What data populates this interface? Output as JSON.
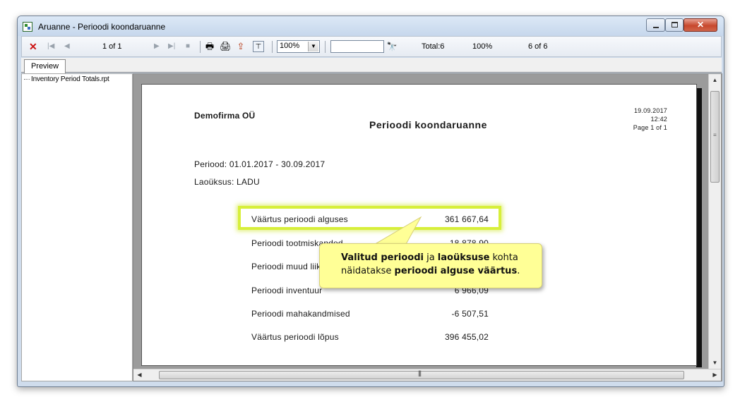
{
  "window": {
    "title": "Aruanne - Perioodi koondaruanne"
  },
  "toolbar": {
    "close_glyph": "✕",
    "first_glyph": "|◀",
    "prev_glyph": "◀",
    "page_indicator": "1 of 1",
    "next_glyph": "▶",
    "last_glyph": "▶|",
    "stop_glyph": "■",
    "zoom_value": "100%",
    "total_label": "Total:6",
    "percent_label": "100%",
    "count_label": "6 of 6",
    "icons": [
      "print-icon",
      "printer-setup-icon",
      "export-icon",
      "group-tree-icon",
      "binoculars-search-icon"
    ]
  },
  "tabs": [
    {
      "label": "Preview"
    }
  ],
  "sidebar": {
    "tree_item": "Inventory Period Totals.rpt"
  },
  "report": {
    "company": "Demofirma OÜ",
    "title": "Perioodi koondaruanne",
    "date": "19.09.2017",
    "time": "12:42",
    "page": "Page 1 of 1",
    "period": "Periood: 01.01.2017 - 30.09.2017",
    "warehouse": "Laoüksus: LADU",
    "rows": [
      {
        "label": "Väärtus perioodi alguses",
        "value": "361 667,64"
      },
      {
        "label": "Perioodi tootmiskanded",
        "value": "18 878,90"
      },
      {
        "label": "Perioodi muud liikumised",
        "value": ""
      },
      {
        "label": "Perioodi inventuur",
        "value": "6 966,09"
      },
      {
        "label": "Perioodi mahakandmised",
        "value": "-6 507,51"
      },
      {
        "label": "Väärtus perioodi lõpus",
        "value": "396 455,02"
      }
    ]
  },
  "callout": {
    "part1": "Valitud perioodi",
    "part2": " ja ",
    "part3": "laoüksuse",
    "part4": " kohta näidatakse ",
    "part5": "perioodi alguse väärtus",
    "part6": "."
  },
  "colors": {
    "highlight": "#d7ef3a",
    "callout_bg": "#ffff96",
    "close_red": "#cc1111"
  }
}
